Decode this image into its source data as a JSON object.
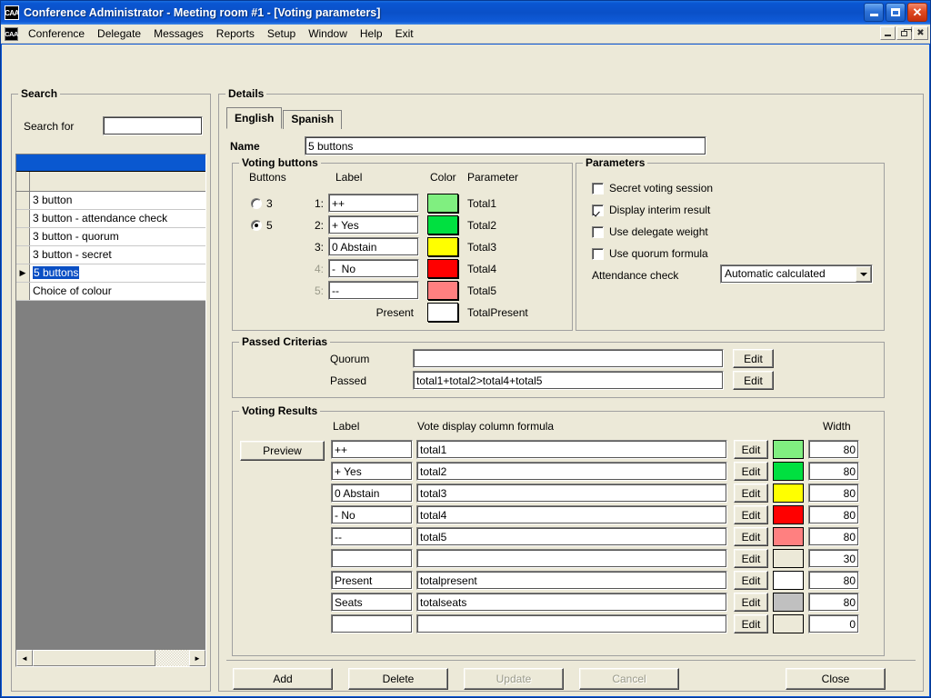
{
  "window": {
    "title": "Conference Administrator - Meeting room #1 - [Voting parameters]",
    "app_icon_text": "CAA",
    "minimize_label": "Minimize",
    "maximize_label": "Maximize",
    "close_label": "Close"
  },
  "menubar": {
    "icon_text": "CAA",
    "items": [
      {
        "label": "Conference"
      },
      {
        "label": "Delegate"
      },
      {
        "label": "Messages"
      },
      {
        "label": "Reports"
      },
      {
        "label": "Setup"
      },
      {
        "label": "Window"
      },
      {
        "label": "Help"
      },
      {
        "label": "Exit"
      }
    ]
  },
  "search": {
    "group_title": "Search",
    "search_for_label": "Search for",
    "search_value": "",
    "search_placeholder": "",
    "grid": {
      "rows": [
        {
          "label": "3 button",
          "selected": false
        },
        {
          "label": "3 button - attendance check",
          "selected": false
        },
        {
          "label": "3 button - quorum",
          "selected": false
        },
        {
          "label": "3 button - secret",
          "selected": false
        },
        {
          "label": "5 buttons",
          "selected": true
        },
        {
          "label": "Choice of colour",
          "selected": false
        }
      ]
    },
    "scroll_left_icon": "◄",
    "scroll_right_icon": "►"
  },
  "details": {
    "group_title": "Details",
    "tabs": [
      {
        "label": "English",
        "active": true
      },
      {
        "label": "Spanish",
        "active": false
      }
    ],
    "name_label": "Name",
    "name_value": "5 buttons"
  },
  "voting_buttons": {
    "group_title": "Voting buttons",
    "headers": {
      "buttons": "Buttons",
      "label": "Label",
      "color": "Color",
      "parameter": "Parameter"
    },
    "radios": [
      {
        "label": "3",
        "checked": false
      },
      {
        "label": "5",
        "checked": true
      }
    ],
    "rows": [
      {
        "num": "1:",
        "label": "++",
        "color": "#80ef80",
        "parameter": "Total1",
        "dim": false
      },
      {
        "num": "2:",
        "label": "+ Yes",
        "color": "#00e040",
        "parameter": "Total2",
        "dim": false
      },
      {
        "num": "3:",
        "label": "0 Abstain",
        "color": "#ffff00",
        "parameter": "Total3",
        "dim": false
      },
      {
        "num": "4:",
        "label": "-  No",
        "color": "#ff0000",
        "parameter": "Total4",
        "dim": true
      },
      {
        "num": "5:",
        "label": "--",
        "color": "#ff8080",
        "parameter": "Total5",
        "dim": true
      }
    ],
    "present_label": "Present",
    "present_color": "#ffffff",
    "present_parameter": "TotalPresent"
  },
  "parameters": {
    "group_title": "Parameters",
    "checkboxes": [
      {
        "label": "Secret voting session",
        "checked": false
      },
      {
        "label": "Display interim result",
        "checked": true
      },
      {
        "label": "Use delegate weight",
        "checked": false
      },
      {
        "label": "Use quorum formula",
        "checked": false
      }
    ],
    "attendance_label": "Attendance check",
    "attendance_value": "Automatic calculated",
    "attendance_options": [
      "Automatic calculated"
    ]
  },
  "passed_criterias": {
    "group_title": "Passed Criterias",
    "quorum_label": "Quorum",
    "quorum_value": "",
    "quorum_edit": "Edit",
    "passed_label": "Passed",
    "passed_value": "total1+total2>total4+total5",
    "passed_edit": "Edit"
  },
  "voting_results": {
    "group_title": "Voting Results",
    "headers": {
      "label": "Label",
      "formula": "Vote display column formula",
      "width": "Width"
    },
    "preview_button": "Preview",
    "edit_label": "Edit",
    "rows": [
      {
        "label": "++",
        "formula": "total1",
        "color": "#80ef80",
        "width": "80"
      },
      {
        "label": "+ Yes",
        "formula": "total2",
        "color": "#00e040",
        "width": "80"
      },
      {
        "label": "0 Abstain",
        "formula": "total3",
        "color": "#ffff00",
        "width": "80"
      },
      {
        "label": "- No",
        "formula": "total4",
        "color": "#ff0000",
        "width": "80"
      },
      {
        "label": "--",
        "formula": "total5",
        "color": "#ff8080",
        "width": "80"
      },
      {
        "label": "",
        "formula": "",
        "color": "#ece9d8",
        "width": "30"
      },
      {
        "label": "Present",
        "formula": "totalpresent",
        "color": "#ffffff",
        "width": "80"
      },
      {
        "label": "Seats",
        "formula": "totalseats",
        "color": "#c0c0c0",
        "width": "80"
      },
      {
        "label": "",
        "formula": "",
        "color": "#ece9d8",
        "width": "0"
      }
    ]
  },
  "footer": {
    "buttons": [
      {
        "label": "Add",
        "disabled": false
      },
      {
        "label": "Delete",
        "disabled": false
      },
      {
        "label": "Update",
        "disabled": true
      },
      {
        "label": "Cancel",
        "disabled": true
      },
      {
        "label": "Close",
        "disabled": false
      }
    ]
  },
  "colors": {
    "titlebar_blue": "#0a56d2",
    "face": "#ece9d8",
    "selection_blue": "#0a4fc4",
    "grid_empty": "#808080"
  }
}
